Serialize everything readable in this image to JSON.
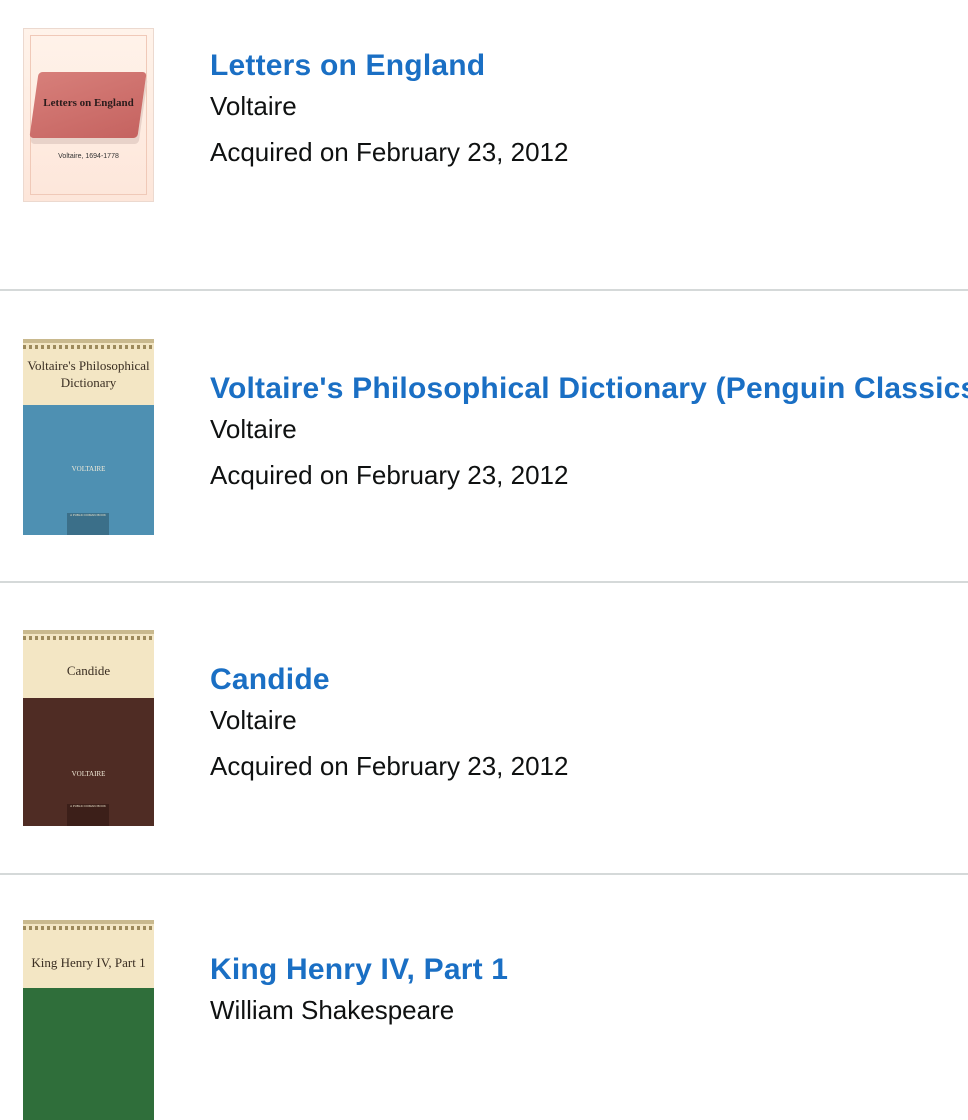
{
  "books": [
    {
      "title": "Letters on England",
      "author": "Voltaire",
      "acquired": "Acquired on February 23, 2012",
      "cover": {
        "title": "Letters on England",
        "subtitle": "Voltaire, 1694-1778",
        "color": "#c56360"
      }
    },
    {
      "title": "Voltaire's Philosophical Dictionary (Penguin Classics)",
      "author": "Voltaire",
      "acquired": "Acquired on February 23, 2012",
      "cover": {
        "title": "Voltaire's Philosophical Dictionary",
        "author": "VOLTAIRE",
        "badge": "A PUBLIC DOMAIN BOOK",
        "color": "#4e90b2"
      }
    },
    {
      "title": "Candide",
      "author": "Voltaire",
      "acquired": "Acquired on February 23, 2012",
      "cover": {
        "title": "Candide",
        "author": "VOLTAIRE",
        "badge": "A PUBLIC DOMAIN BOOK",
        "color": "#4f2c24"
      }
    },
    {
      "title": "King Henry IV, Part 1",
      "author": "William Shakespeare",
      "cover": {
        "title": "King Henry IV, Part 1",
        "color": "#2f6e3a"
      }
    }
  ],
  "colors": {
    "link": "#1a6fc4",
    "divider": "#d5d9d9"
  }
}
